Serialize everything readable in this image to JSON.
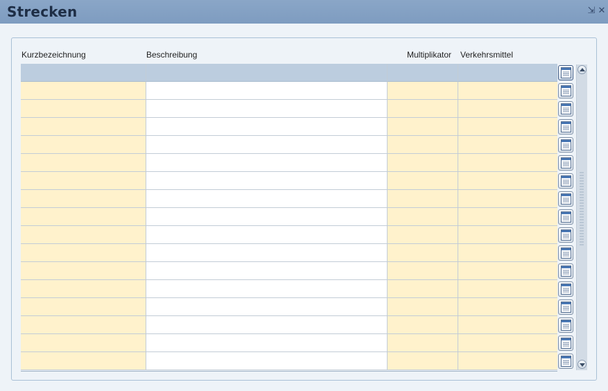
{
  "window": {
    "title": "Strecken",
    "minimize_glyph": "⇲",
    "close_glyph": "✕"
  },
  "table": {
    "columns": [
      {
        "key": "kurz",
        "label": "Kurzbezeichnung"
      },
      {
        "key": "besch",
        "label": "Beschreibung"
      },
      {
        "key": "mult",
        "label": "Multiplikator"
      },
      {
        "key": "verk",
        "label": "Verkehrsmittel"
      }
    ],
    "filter_row": {
      "kurz": "",
      "besch": "",
      "mult": "",
      "verk": ""
    },
    "rows": [
      {
        "kurz": "",
        "besch": "",
        "mult": "",
        "verk": ""
      },
      {
        "kurz": "",
        "besch": "",
        "mult": "",
        "verk": ""
      },
      {
        "kurz": "",
        "besch": "",
        "mult": "",
        "verk": ""
      },
      {
        "kurz": "",
        "besch": "",
        "mult": "",
        "verk": ""
      },
      {
        "kurz": "",
        "besch": "",
        "mult": "",
        "verk": ""
      },
      {
        "kurz": "",
        "besch": "",
        "mult": "",
        "verk": ""
      },
      {
        "kurz": "",
        "besch": "",
        "mult": "",
        "verk": ""
      },
      {
        "kurz": "",
        "besch": "",
        "mult": "",
        "verk": ""
      },
      {
        "kurz": "",
        "besch": "",
        "mult": "",
        "verk": ""
      },
      {
        "kurz": "",
        "besch": "",
        "mult": "",
        "verk": ""
      },
      {
        "kurz": "",
        "besch": "",
        "mult": "",
        "verk": ""
      },
      {
        "kurz": "",
        "besch": "",
        "mult": "",
        "verk": ""
      },
      {
        "kurz": "",
        "besch": "",
        "mult": "",
        "verk": ""
      },
      {
        "kurz": "",
        "besch": "",
        "mult": "",
        "verk": ""
      },
      {
        "kurz": "",
        "besch": "",
        "mult": "",
        "verk": ""
      },
      {
        "kurz": "",
        "besch": "",
        "mult": "",
        "verk": ""
      }
    ],
    "row_button_icon": "record-details-icon"
  },
  "colors": {
    "titlebar": "#8aa6c7",
    "editable_cell": "#fff2cc",
    "filter_row": "#bccddf",
    "panel_border": "#a9c0d6"
  }
}
